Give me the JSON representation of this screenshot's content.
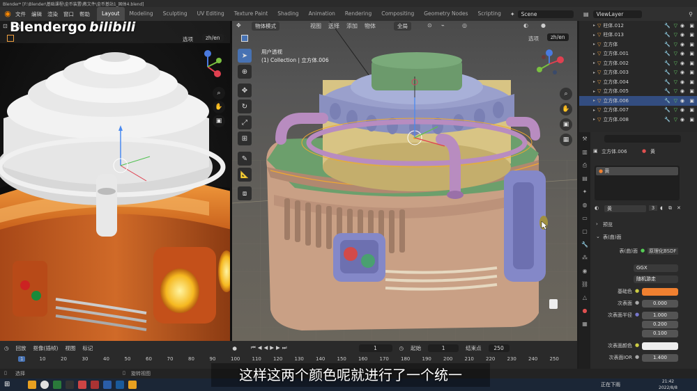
{
  "titlebar": {
    "text": "Blender* [F:\\Blender\\基础课程\\金币装置\\教文件\\金币基站1_固体4.blend]"
  },
  "topbar": {
    "menu": [
      "文件",
      "编辑",
      "渲染",
      "窗口",
      "帮助"
    ],
    "workspaces": [
      "Layout",
      "Modeling",
      "Sculpting",
      "UV Editing",
      "Texture Paint",
      "Shading",
      "Animation",
      "Rendering",
      "Compositing",
      "Geometry Nodes",
      "Scripting"
    ],
    "active_workspace": "Layout",
    "scene": "Scene",
    "viewlayer": "ViewLayer"
  },
  "watermark": {
    "text": "Blendergo",
    "site": "bilibili"
  },
  "left_viewport": {
    "mode": "物体",
    "options": "选项",
    "lang": "zh/en"
  },
  "right_viewport": {
    "mode": "物体模式",
    "menus": [
      "视图",
      "选择",
      "添加",
      "物体"
    ],
    "transform": "全局",
    "options": "选项",
    "lang": "zh/en",
    "view_name": "用户透视",
    "collection": "(1) Collection | 立方体.006"
  },
  "outliner": {
    "items": [
      {
        "name": "柱体.012",
        "selected": false
      },
      {
        "name": "柱体.013",
        "selected": false
      },
      {
        "name": "立方体",
        "selected": false
      },
      {
        "name": "立方体.001",
        "selected": false
      },
      {
        "name": "立方体.002",
        "selected": false
      },
      {
        "name": "立方体.003",
        "selected": false
      },
      {
        "name": "立方体.004",
        "selected": false
      },
      {
        "name": "立方体.005",
        "selected": false
      },
      {
        "name": "立方体.006",
        "selected": true
      },
      {
        "name": "立方体.007",
        "selected": false
      },
      {
        "name": "立方体.008",
        "selected": false
      }
    ]
  },
  "properties": {
    "object": "立方体.006",
    "material_short": "黄",
    "slot": "黄",
    "material": "黄",
    "users": "3",
    "preview": "预览",
    "surface_section": "表(曲)面",
    "surface_label": "表(曲)面",
    "surface_value": "原理化BSDF",
    "distribution": "GGX",
    "subsurface_method": "随机游走",
    "base_color_label": "基础色",
    "base_color": "#f08030",
    "subsurface_label": "次表面",
    "subsurface": "0.000",
    "radius_label": "次表面半径",
    "radius": [
      "1.000",
      "0.200",
      "0.100"
    ],
    "ss_color_label": "次表面颜色",
    "ior_label": "次表面IOR",
    "ior": "1.400"
  },
  "timeline": {
    "menus": [
      "回放",
      "抠像(插帧)",
      "视图",
      "标记"
    ],
    "current_frame": "1",
    "start_label": "起始",
    "start": "1",
    "end_label": "结束点",
    "end": "250",
    "ruler": [
      "1",
      "10",
      "20",
      "30",
      "40",
      "50",
      "60",
      "70",
      "80",
      "90",
      "100",
      "110",
      "120",
      "130",
      "140",
      "150",
      "160",
      "170",
      "180",
      "190",
      "200",
      "210",
      "220",
      "230",
      "240",
      "250"
    ]
  },
  "statusbar": {
    "select": "选择",
    "rotate": "旋转视图",
    "time": "21:42",
    "date": "2022/8/8",
    "search": "在这里搜索",
    "pin": "正在下雨"
  },
  "subtitle": "这样这两个颜色呢就进行了一个统一"
}
